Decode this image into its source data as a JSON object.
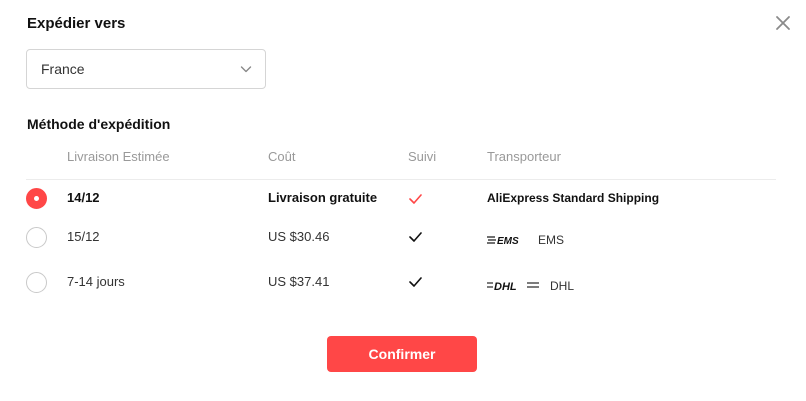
{
  "dialog": {
    "title": "Expédier vers"
  },
  "country_select": {
    "value": "France"
  },
  "shipping": {
    "section_title": "Méthode d'expédition",
    "headers": {
      "delivery": "Livraison Estimée",
      "cost": "Coût",
      "tracking": "Suivi",
      "carrier": "Transporteur"
    },
    "rows": [
      {
        "delivery": "14/12",
        "cost": "Livraison gratuite",
        "tracked": true,
        "carrier": "AliExpress Standard Shipping",
        "selected": true
      },
      {
        "delivery": "15/12",
        "cost": "US $30.46",
        "tracked": true,
        "carrier": "EMS",
        "logo_text": "EMS",
        "selected": false
      },
      {
        "delivery": "7-14 jours",
        "cost": "US $37.41",
        "tracked": true,
        "carrier": "DHL",
        "logo_text": "DHL",
        "selected": false
      }
    ]
  },
  "buttons": {
    "confirm": "Confirmer"
  },
  "colors": {
    "accent": "#ff4747",
    "check_selected": "#ff4747",
    "check_default": "#111111"
  }
}
